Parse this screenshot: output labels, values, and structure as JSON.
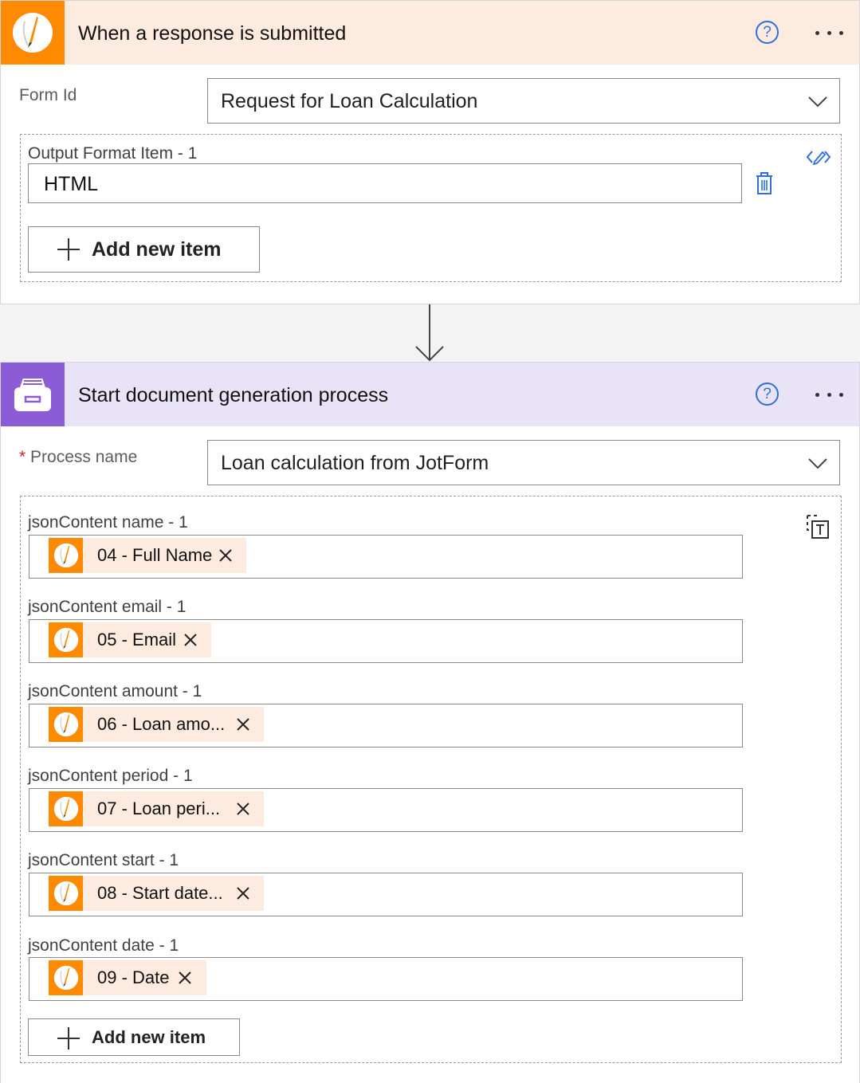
{
  "trigger": {
    "title": "When a response is submitted",
    "icon": "jotform-pencil-icon",
    "help_label": "?",
    "form_id_label": "Form Id",
    "form_id_value": "Request for Loan Calculation",
    "output_item_label": "Output Format Item - 1",
    "output_item_value": "HTML",
    "add_new_item_label": "Add new item"
  },
  "action": {
    "title": "Start document generation process",
    "icon": "file-cabinet-icon",
    "help_label": "?",
    "required_marker": "*",
    "process_name_label": "Process name",
    "process_name_value": "Loan calculation from JotForm",
    "items": [
      {
        "label": "jsonContent name - 1",
        "token": "04 - Full Name"
      },
      {
        "label": "jsonContent email - 1",
        "token": "05 - Email"
      },
      {
        "label": "jsonContent amount - 1",
        "token": "06 - Loan amo..."
      },
      {
        "label": "jsonContent period - 1",
        "token": "07 - Loan peri..."
      },
      {
        "label": "jsonContent start - 1",
        "token": "08 - Start date..."
      },
      {
        "label": "jsonContent date - 1",
        "token": "09 - Date"
      }
    ],
    "add_new_item_label": "Add new item"
  },
  "colors": {
    "jotform_orange": "#ff8a00",
    "trigger_header_bg": "#fdebdf",
    "action_purple": "#8b5cd6",
    "action_header_bg": "#e9e3f7",
    "link_blue": "#2f6fd8",
    "required_red": "#c4262e"
  }
}
